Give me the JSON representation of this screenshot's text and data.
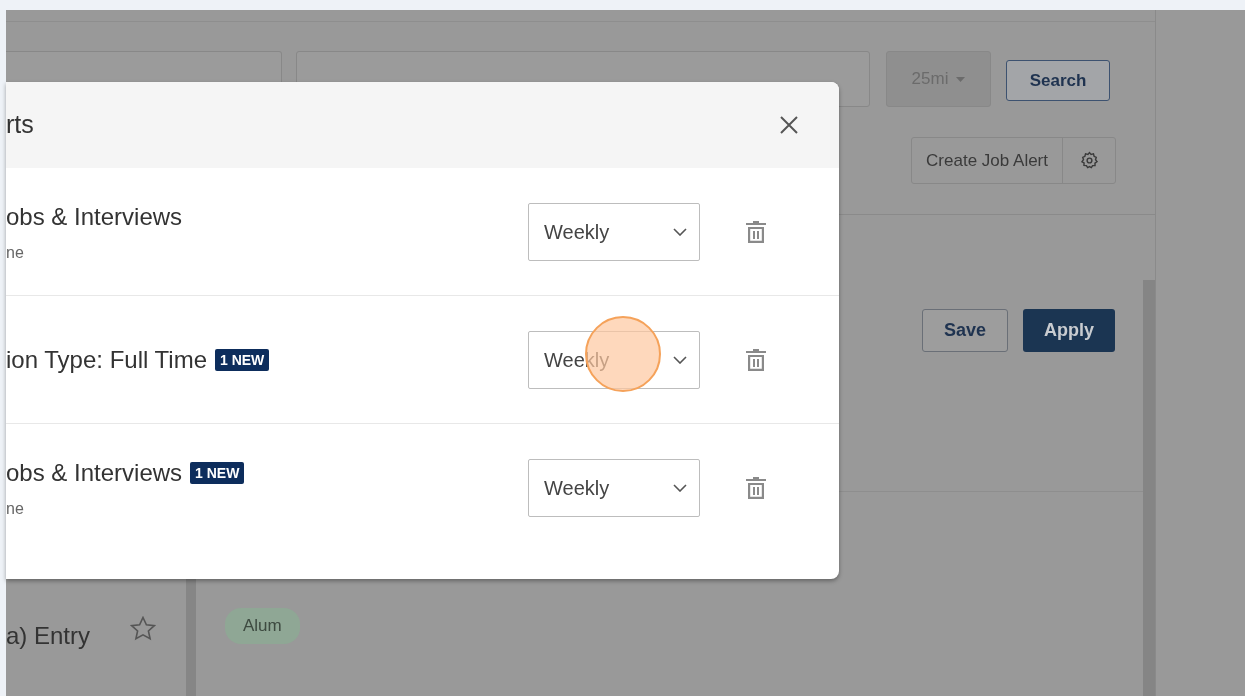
{
  "page": {
    "radius": "25mi",
    "search_button": "Search",
    "create_alert_button": "Create Job Alert",
    "job": {
      "title": "a) Entry",
      "starred": false
    },
    "save_button": "Save",
    "apply_button": "Apply",
    "tags": [
      "Alum"
    ]
  },
  "modal": {
    "title": "rts",
    "alerts": [
      {
        "name": "obs & Interviews",
        "subtitle": "ne",
        "frequency": "Weekly"
      },
      {
        "name": "ion Type: Full Time",
        "badge": "1 NEW",
        "frequency": "Weekly"
      },
      {
        "name": "obs & Interviews",
        "badge": "1 NEW",
        "subtitle": "ne",
        "frequency": "Weekly"
      }
    ]
  }
}
